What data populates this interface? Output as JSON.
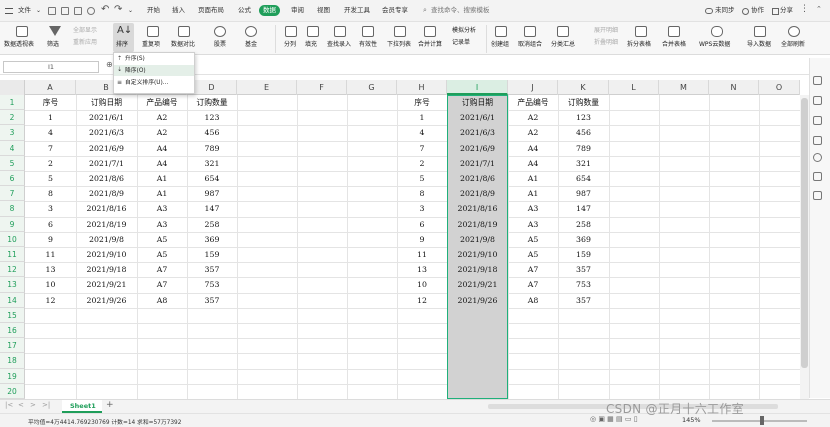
{
  "menubar": {
    "file_label": "文件",
    "tabs": [
      "开始",
      "插入",
      "页面布局",
      "公式",
      "数据",
      "审阅",
      "视图",
      "开发工具",
      "会员专享"
    ],
    "active_tab": "数据",
    "search_placeholder": "查找命令、搜索模板",
    "sync_label": "未同步",
    "collab_label": "协作",
    "share_label": "分享"
  },
  "ribbon": {
    "pivot": "数据透视表",
    "filter_top": "全部显示",
    "filter_bottom": "重新应用",
    "filter": "筛选",
    "sort": "排序",
    "dup": "重复项",
    "compare": "数据对比",
    "stock": "股票",
    "fund": "基金",
    "split": "分列",
    "fill": "填充",
    "lookup": "查找录入",
    "valid": "有效性",
    "dropdown": "下拉列表",
    "consolidate": "合并计算",
    "sim": "模拟分析",
    "record": "记录单",
    "group": "创建组",
    "ungroup": "取消组合",
    "subtotal": "分类汇总",
    "expand": "展开明细",
    "collapse": "折叠明细",
    "splittable": "拆分表格",
    "mergetable": "合并表格",
    "wps": "WPS云数据",
    "import": "导入数据",
    "refresh": "全部刷新"
  },
  "sort_menu": {
    "items": [
      "升序(S)",
      "降序(O)",
      "自定义排序(U)..."
    ]
  },
  "namebox": "I1",
  "columns": [
    "A",
    "B",
    "C",
    "D",
    "E",
    "F",
    "G",
    "H",
    "I",
    "J",
    "K",
    "L",
    "M",
    "N",
    "O"
  ],
  "selected_column": "I",
  "rows": [
    "1",
    "2",
    "3",
    "4",
    "5",
    "6",
    "7",
    "8",
    "9",
    "10",
    "11",
    "12",
    "13",
    "14",
    "15",
    "16",
    "17",
    "18",
    "19",
    "20"
  ],
  "headers": [
    "序号",
    "订购日期",
    "产品编号",
    "订购数量"
  ],
  "left_table": [
    [
      "1",
      "2021/6/1",
      "A2",
      "123"
    ],
    [
      "4",
      "2021/6/3",
      "A2",
      "456"
    ],
    [
      "7",
      "2021/6/9",
      "A4",
      "789"
    ],
    [
      "2",
      "2021/7/1",
      "A4",
      "321"
    ],
    [
      "5",
      "2021/8/6",
      "A1",
      "654"
    ],
    [
      "8",
      "2021/8/9",
      "A1",
      "987"
    ],
    [
      "3",
      "2021/8/16",
      "A3",
      "147"
    ],
    [
      "6",
      "2021/8/19",
      "A3",
      "258"
    ],
    [
      "9",
      "2021/9/8",
      "A5",
      "369"
    ],
    [
      "11",
      "2021/9/10",
      "A5",
      "159"
    ],
    [
      "13",
      "2021/9/18",
      "A7",
      "357"
    ],
    [
      "10",
      "2021/9/21",
      "A7",
      "753"
    ],
    [
      "12",
      "2021/9/26",
      "A8",
      "357"
    ]
  ],
  "right_table": [
    [
      "1",
      "2021/6/1",
      "A2",
      "123"
    ],
    [
      "4",
      "2021/6/3",
      "A2",
      "456"
    ],
    [
      "7",
      "2021/6/9",
      "A4",
      "789"
    ],
    [
      "2",
      "2021/7/1",
      "A4",
      "321"
    ],
    [
      "5",
      "2021/8/6",
      "A1",
      "654"
    ],
    [
      "8",
      "2021/8/9",
      "A1",
      "987"
    ],
    [
      "3",
      "2021/8/16",
      "A3",
      "147"
    ],
    [
      "6",
      "2021/8/19",
      "A3",
      "258"
    ],
    [
      "9",
      "2021/9/8",
      "A5",
      "369"
    ],
    [
      "11",
      "2021/9/10",
      "A5",
      "159"
    ],
    [
      "13",
      "2021/9/18",
      "A7",
      "357"
    ],
    [
      "10",
      "2021/9/21",
      "A7",
      "753"
    ],
    [
      "12",
      "2021/9/26",
      "A8",
      "357"
    ]
  ],
  "sheet_tab": "Sheet1",
  "status": {
    "summary": "平均值=4万4414.769230769  计数=14  求和=57万7392",
    "zoom": "145%"
  },
  "watermark": "CSDN @正月十六工作室",
  "colors": {
    "accent": "#1f9e5a",
    "selection_fill": "#d2d2d2",
    "selection_border": "#1fb07a"
  }
}
